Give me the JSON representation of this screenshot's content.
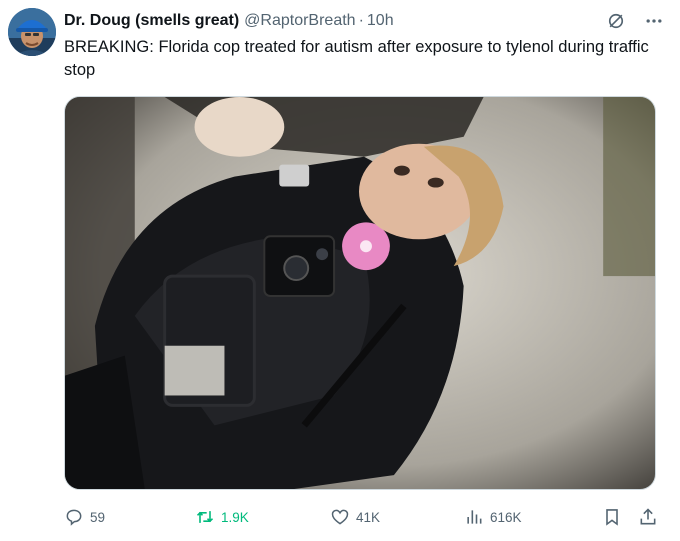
{
  "tweet": {
    "author": {
      "display_name": "Dr. Doug (smells great)",
      "handle": "@RaptorBreath",
      "separator": "·",
      "time": "10h",
      "avatar": "avatar-man-blue-hard-hat"
    },
    "text": "BREAKING: Florida cop treated for autism after exposure to tylenol during traffic stop",
    "media": {
      "kind": "photo",
      "subject": "police-officer-lying-on-ground",
      "badge_color": "#e889c4"
    },
    "header_icons": [
      "grok-icon",
      "more-icon"
    ],
    "actions": {
      "replies": "59",
      "reposts": "1.9K",
      "likes": "41K",
      "views": "616K",
      "icons": [
        "reply-icon",
        "repost-icon",
        "like-icon",
        "views-icon",
        "bookmark-icon",
        "share-icon"
      ]
    }
  },
  "colors": {
    "text_primary": "#0f1419",
    "text_secondary": "#536471",
    "repost_active": "#00ba7c",
    "border": "#cfd9de"
  }
}
